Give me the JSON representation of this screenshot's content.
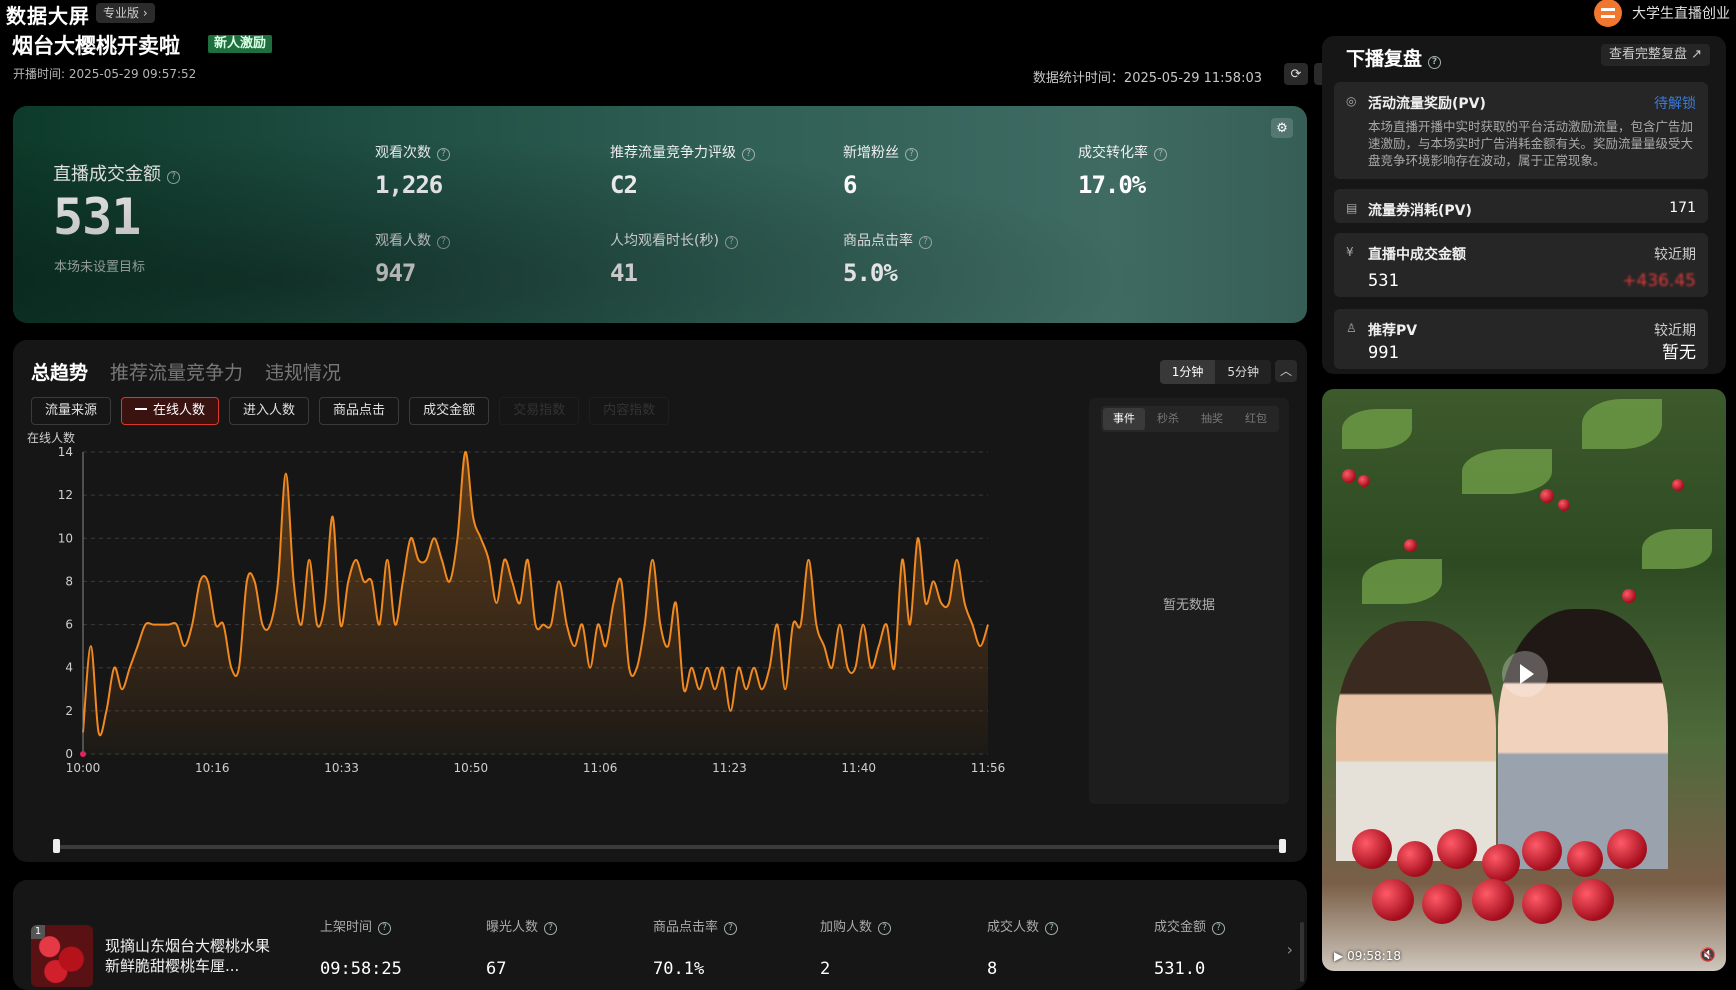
{
  "header": {
    "app_title": "数据大屏",
    "edition": "专业版",
    "account_name": "大学生直播创业",
    "stream_title": "烟台大樱桃开卖啦",
    "stream_badge": "新人激励",
    "start_time": "开播时间: 2025-05-29 09:57:52",
    "stats_time": "数据统计时间：2025-05-29 11:58:03"
  },
  "kpi": {
    "main_label": "直播成交金额",
    "main_value": "531",
    "main_sub": "本场未设置目标",
    "items": [
      {
        "label": "观看次数",
        "value": "1,226"
      },
      {
        "label": "推荐流量竞争力评级",
        "value": "C2"
      },
      {
        "label": "新增粉丝",
        "value": "6"
      },
      {
        "label": "成交转化率",
        "value": "17.0%"
      },
      {
        "label": "观看人数",
        "value": "947"
      },
      {
        "label": "人均观看时长(秒)",
        "value": "41"
      },
      {
        "label": "商品点击率",
        "value": "5.0%"
      }
    ]
  },
  "trend": {
    "tabs": [
      "总趋势",
      "推荐流量竞争力",
      "违规情况"
    ],
    "intervals": [
      "1分钟",
      "5分钟"
    ],
    "metrics": [
      "流量来源",
      "在线人数",
      "进入人数",
      "商品点击",
      "成交金额",
      "交易指数",
      "内容指数"
    ],
    "event_tabs": [
      "事件",
      "秒杀",
      "抽奖",
      "红包"
    ],
    "empty_text": "暂无数据"
  },
  "chart_data": {
    "type": "line",
    "ylabel": "在线人数",
    "ylim": [
      0,
      14
    ],
    "yticks": [
      0,
      2,
      4,
      6,
      8,
      10,
      12,
      14
    ],
    "xticks": [
      "10:00",
      "10:16",
      "10:33",
      "10:50",
      "11:06",
      "11:23",
      "11:40",
      "11:56"
    ],
    "xlim_minutes": [
      0,
      116
    ],
    "series": [
      {
        "color": "#f0891f",
        "x": [
          0,
          1,
          2,
          3,
          4,
          5,
          6,
          7,
          8,
          9,
          10,
          11,
          12,
          13,
          14,
          15,
          16,
          17,
          18,
          19,
          20,
          21,
          22,
          23,
          24,
          25,
          26,
          27,
          28,
          29,
          30,
          31,
          32,
          33,
          34,
          35,
          36,
          37,
          38,
          39,
          40,
          41,
          42,
          43,
          44,
          45,
          46,
          47,
          48,
          49,
          50,
          51,
          52,
          53,
          54,
          55,
          56,
          57,
          58,
          59,
          60,
          61,
          62,
          63,
          64,
          65,
          66,
          67,
          68,
          69,
          70,
          71,
          72,
          73,
          74,
          75,
          76,
          77,
          78,
          79,
          80,
          81,
          82,
          83,
          84,
          85,
          86,
          87,
          88,
          89,
          90,
          91,
          92,
          93,
          94,
          95,
          96,
          97,
          98,
          99,
          100,
          101,
          102,
          103,
          104,
          105,
          106,
          107,
          108,
          109,
          110,
          111,
          112,
          113,
          114,
          115,
          116
        ],
        "values": [
          1,
          5,
          1,
          2,
          4,
          3,
          4,
          5,
          6,
          6,
          6,
          6,
          6,
          5,
          6,
          8,
          8,
          6,
          6,
          4,
          4,
          8,
          8,
          6,
          6,
          8,
          13,
          8,
          6,
          9,
          6,
          7,
          11,
          6,
          8,
          9,
          8,
          8,
          6,
          9,
          6,
          8,
          10,
          9,
          9,
          10,
          9,
          8,
          10,
          14,
          11,
          10,
          9,
          7,
          9,
          8,
          7,
          9,
          6,
          6,
          6,
          8,
          6,
          5,
          6,
          4,
          6,
          5,
          7,
          8,
          4,
          4,
          6,
          9,
          6,
          5,
          7,
          3,
          4,
          3,
          4,
          3,
          4,
          2,
          4,
          3,
          4,
          3,
          4,
          6,
          3,
          6,
          6,
          9,
          6,
          5,
          4,
          6,
          4,
          4,
          6,
          4,
          5,
          6,
          4,
          9,
          6,
          10,
          7,
          8,
          7,
          7,
          9,
          7,
          6,
          5,
          6
        ]
      }
    ]
  },
  "review": {
    "title": "下播复盘",
    "link_text": "查看完整复盘",
    "items": [
      {
        "name": "活动流量奖励(PV)",
        "right": "待解锁",
        "desc": "本场直播开播中实时获取的平台活动激励流量，包含广告加速激励，与本场实时广告消耗金额有关。奖励流量量级受大盘竞争环境影响存在波动，属于正常现象。"
      },
      {
        "name": "流量券消耗(PV)",
        "right": "171"
      },
      {
        "name": "直播中成交金额",
        "right": "较近期",
        "value": "531",
        "value_right": "+436.45"
      },
      {
        "name": "推荐PV",
        "right": "较近期",
        "value": "991",
        "value_right": "暂无"
      }
    ]
  },
  "video": {
    "time": "09:58:18"
  },
  "product": {
    "index": "1",
    "name": "现摘山东烟台大樱桃水果新鲜脆甜樱桃车厘...",
    "columns": [
      {
        "label": "上架时间",
        "value": "09:58:25"
      },
      {
        "label": "曝光人数",
        "value": "67"
      },
      {
        "label": "商品点击率",
        "value": "70.1%"
      },
      {
        "label": "加购人数",
        "value": "2"
      },
      {
        "label": "成交人数",
        "value": "8"
      },
      {
        "label": "成交金额",
        "value": "531.0"
      }
    ]
  },
  "colors": {
    "accent": "#f0891f",
    "alert_red": "#e03a3a",
    "positive_green": "#1f6e3d"
  }
}
